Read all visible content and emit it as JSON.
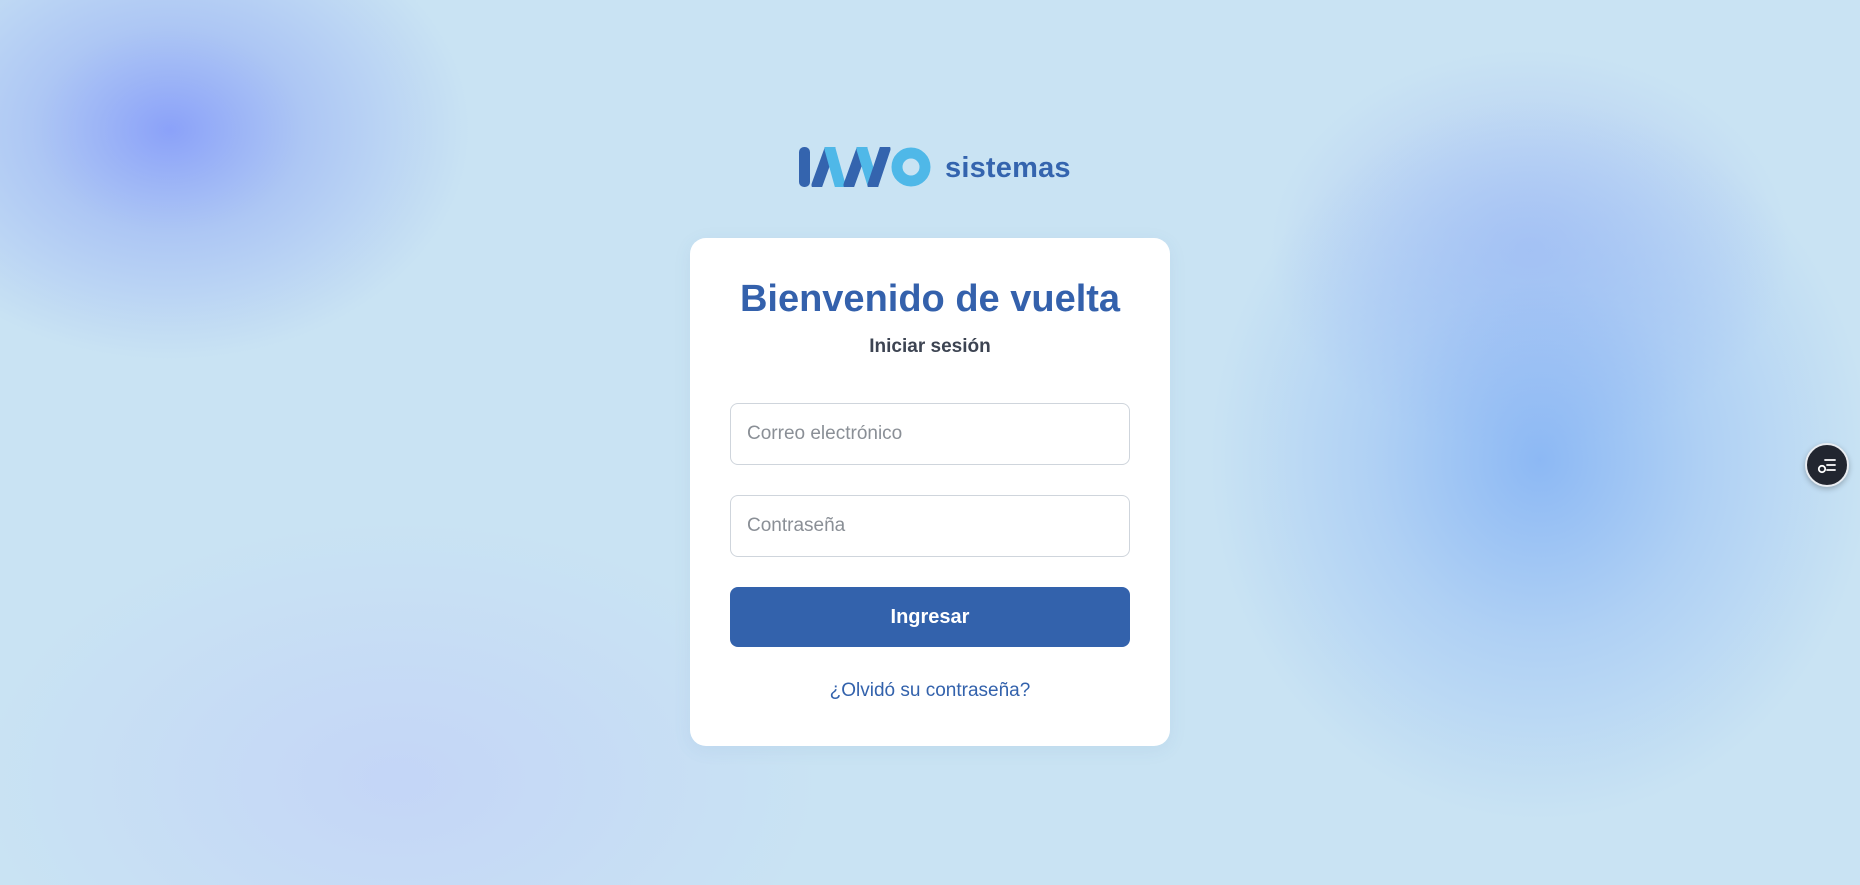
{
  "brand": {
    "logo_mark_icon": "inno-logo-mark",
    "wordmark": "sistemas",
    "colors": {
      "dark_blue": "#3464ae",
      "light_blue": "#4fb8e8"
    }
  },
  "login": {
    "title": "Bienvenido de vuelta",
    "subtitle": "Iniciar sesión",
    "email_placeholder": "Correo electrónico",
    "password_placeholder": "Contraseña",
    "submit_label": "Ingresar",
    "forgot_label": "¿Olvidó su contraseña?"
  },
  "floating_widget": {
    "icon": "accessibility-menu-icon"
  },
  "colors": {
    "background": "#c9e3f3",
    "primary": "#3362ac",
    "card": "#ffffff"
  }
}
